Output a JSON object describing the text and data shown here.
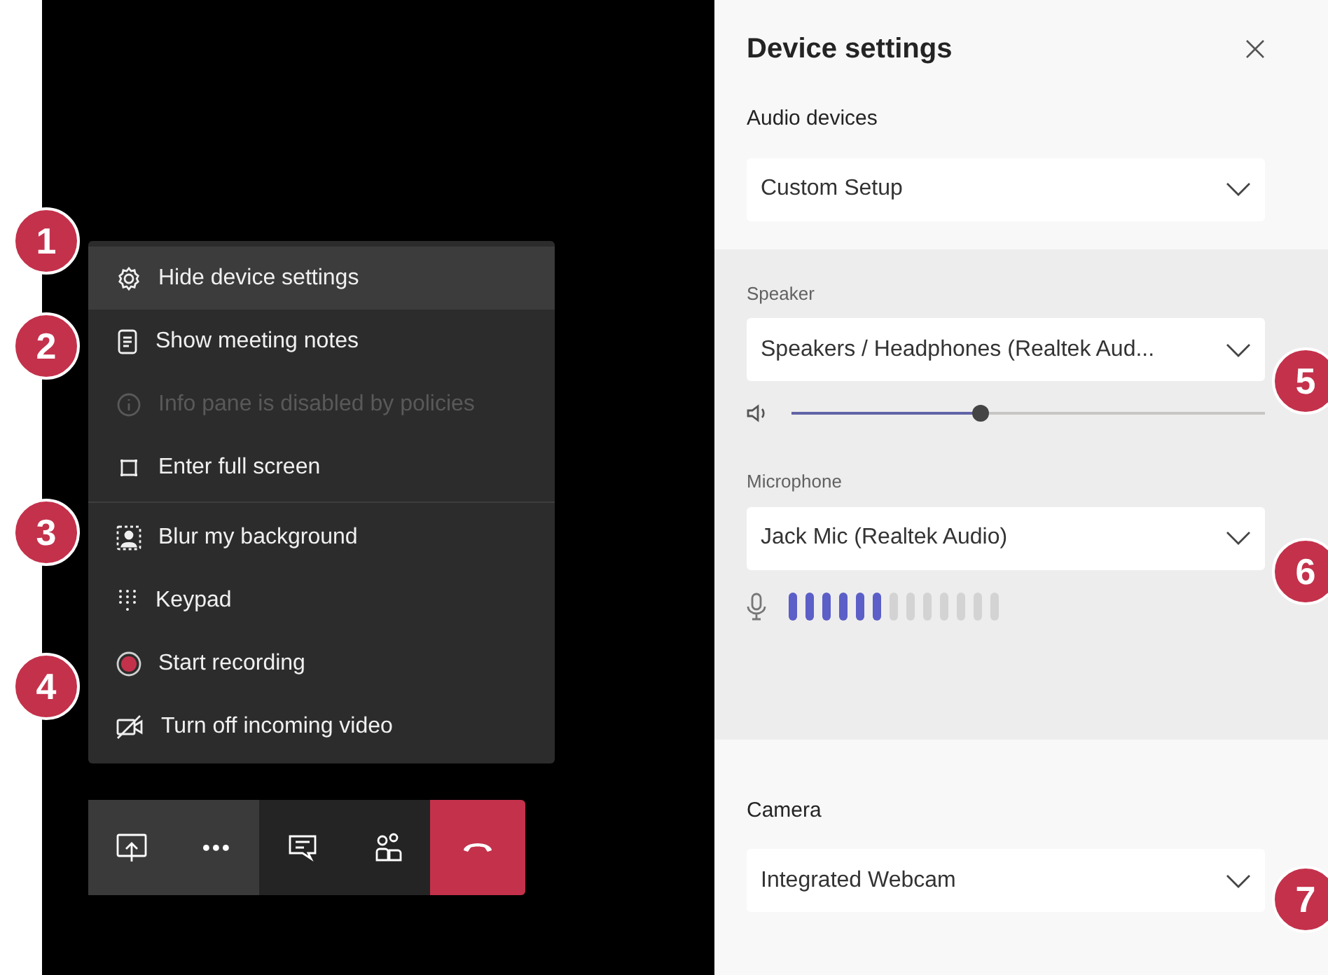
{
  "menu": {
    "sections": [
      [
        {
          "label": "Hide device settings",
          "selected": true,
          "disabled": false
        },
        {
          "label": "Show meeting notes",
          "selected": false,
          "disabled": false
        },
        {
          "label": "Info pane is disabled by policies",
          "selected": false,
          "disabled": true
        },
        {
          "label": "Enter full screen",
          "selected": false,
          "disabled": false
        }
      ],
      [
        {
          "label": "Blur my background",
          "selected": false,
          "disabled": false
        },
        {
          "label": "Keypad",
          "selected": false,
          "disabled": false
        },
        {
          "label": "Start recording",
          "selected": false,
          "disabled": false
        },
        {
          "label": "Turn off incoming video",
          "selected": false,
          "disabled": false
        }
      ]
    ]
  },
  "device_settings": {
    "title": "Device settings",
    "audio_devices": {
      "label": "Audio devices",
      "value": "Custom Setup"
    },
    "speaker": {
      "label": "Speaker",
      "value": "Speakers / Headphones (Realtek Aud...",
      "level": 0.4
    },
    "microphone": {
      "label": "Microphone",
      "value": "Jack Mic (Realtek Audio)",
      "level": 0.46
    },
    "camera": {
      "label": "Camera",
      "value": "Integrated Webcam"
    }
  },
  "callouts": [
    "1",
    "2",
    "3",
    "4",
    "5",
    "6",
    "7"
  ]
}
